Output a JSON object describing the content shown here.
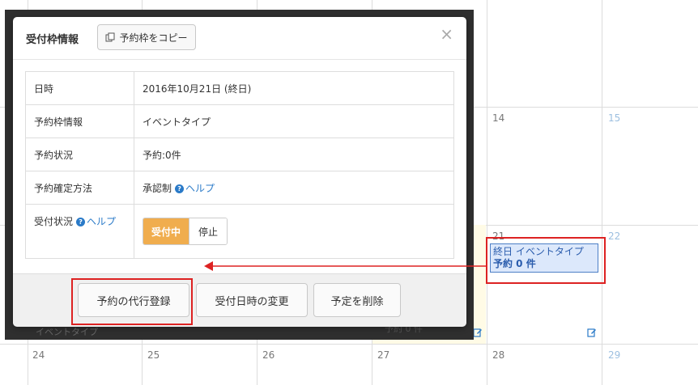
{
  "calendar": {
    "days": {
      "d14": "14",
      "d15": "15",
      "d21": "21",
      "d22": "22",
      "d24": "24",
      "d25": "25",
      "d26": "26",
      "d27": "27",
      "d28": "28",
      "d29": "29"
    },
    "event": {
      "line1": "終日 イベントタイプ",
      "line2": "予約 0 件"
    },
    "ghost_event_1": "予約 0 件",
    "ghost_event_2": "イベントタイプ"
  },
  "modal": {
    "title": "受付枠情報",
    "copy_button": "予約枠をコピー",
    "close": "×",
    "rows": {
      "datetime": {
        "label": "日時",
        "value": "2016年10月21日 (終日)"
      },
      "slot_info": {
        "label": "予約枠情報",
        "value": "イベントタイプ"
      },
      "status": {
        "label": "予約状況",
        "value": "予約:0件"
      },
      "confirm_method": {
        "label": "予約確定方法",
        "value": "承認制",
        "help": "ヘルプ"
      },
      "accept_status": {
        "label": "受付状況",
        "help": "ヘルプ",
        "toggle_on": "受付中",
        "toggle_off": "停止"
      }
    },
    "footer": {
      "proxy_register": "予約の代行登録",
      "change_datetime": "受付日時の変更",
      "delete": "予定を削除"
    }
  },
  "colors": {
    "accent": "#f0ad4e",
    "link": "#2a7ac8",
    "annotation": "#dd2222",
    "event_fill": "#dce8fb"
  }
}
